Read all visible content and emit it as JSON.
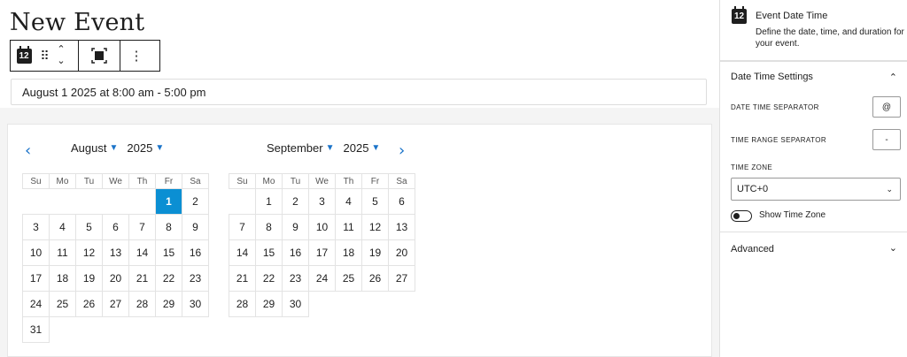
{
  "page": {
    "title": "New Event"
  },
  "toolbar": {
    "block_icon_text": "12",
    "drag_glyph": "⠿",
    "move_up_glyph": "⌃",
    "move_down_glyph": "⌄",
    "options_glyph": "⋮"
  },
  "date_field": {
    "value": "August 1 2025 at 8:00 am - 5:00 pm"
  },
  "calendar": {
    "prev_glyph": "‹",
    "next_glyph": "›",
    "left": {
      "month": "August",
      "year": "2025",
      "weekdays": [
        "Su",
        "Mo",
        "Tu",
        "We",
        "Th",
        "Fr",
        "Sa"
      ],
      "weeks": [
        [
          "",
          "",
          "",
          "",
          "",
          "1",
          "2"
        ],
        [
          "3",
          "4",
          "5",
          "6",
          "7",
          "8",
          "9"
        ],
        [
          "10",
          "11",
          "12",
          "13",
          "14",
          "15",
          "16"
        ],
        [
          "17",
          "18",
          "19",
          "20",
          "21",
          "22",
          "23"
        ],
        [
          "24",
          "25",
          "26",
          "27",
          "28",
          "29",
          "30"
        ],
        [
          "31",
          "",
          "",
          "",
          "",
          "",
          ""
        ]
      ],
      "selected": "1"
    },
    "right": {
      "month": "September",
      "year": "2025",
      "weekdays": [
        "Su",
        "Mo",
        "Tu",
        "We",
        "Th",
        "Fr",
        "Sa"
      ],
      "weeks": [
        [
          "",
          "1",
          "2",
          "3",
          "4",
          "5",
          "6"
        ],
        [
          "7",
          "8",
          "9",
          "10",
          "11",
          "12",
          "13"
        ],
        [
          "14",
          "15",
          "16",
          "17",
          "18",
          "19",
          "20"
        ],
        [
          "21",
          "22",
          "23",
          "24",
          "25",
          "26",
          "27"
        ],
        [
          "28",
          "29",
          "30",
          "",
          "",
          "",
          ""
        ]
      ],
      "selected": ""
    }
  },
  "sidebar": {
    "icon_text": "12",
    "title": "Event Date Time",
    "description": "Define the date, time, and duration for your event.",
    "date_time_settings": {
      "title": "Date Time Settings",
      "chevron": "⌃",
      "date_time_separator_label": "DATE TIME SEPARATOR",
      "date_time_separator_value": "@",
      "time_range_separator_label": "TIME RANGE SEPARATOR",
      "time_range_separator_value": "-",
      "time_zone_label": "TIME ZONE",
      "time_zone_value": "UTC+0",
      "show_time_zone_label": "Show Time Zone",
      "show_time_zone": false
    },
    "advanced": {
      "title": "Advanced",
      "chevron": "⌄"
    }
  },
  "colors": {
    "accent": "#0b8fd3",
    "nav": "#1a73c9",
    "text": "#1e1e1e"
  }
}
